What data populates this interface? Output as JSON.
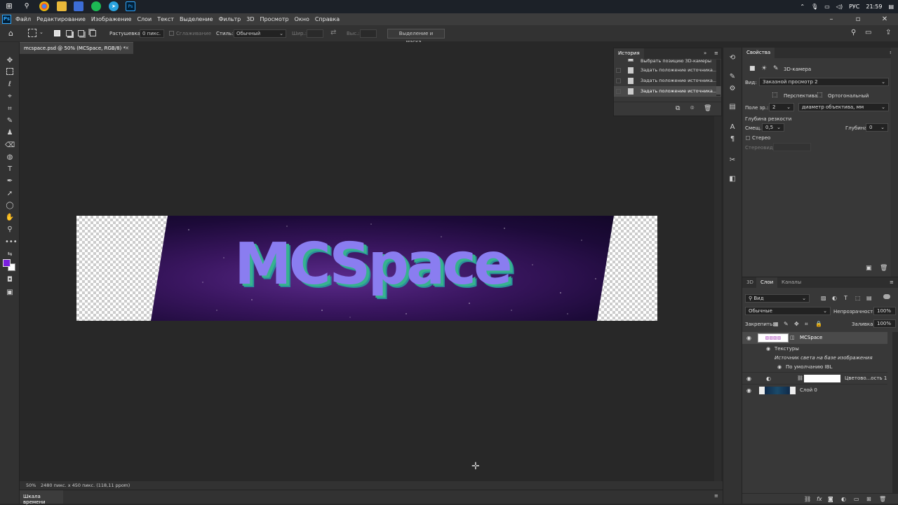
{
  "taskbar": {
    "tray": {
      "language": "РУС",
      "time": "21:59"
    }
  },
  "menubar": {
    "app_icon": "Ps",
    "items": [
      "Файл",
      "Редактирование",
      "Изображение",
      "Слои",
      "Текст",
      "Выделение",
      "Фильтр",
      "3D",
      "Просмотр",
      "Окно",
      "Справка"
    ],
    "window_controls": [
      "–",
      "▫",
      "✕"
    ]
  },
  "options": {
    "feather_label": "Растушевка:",
    "feather_value": "0 пикс.",
    "antialias_label": "Сглаживание",
    "style_label": "Стиль:",
    "style_value": "Обычный",
    "width_label": "Шир.:",
    "height_label": "Выс.:",
    "select_mask_button": "Выделение и маска..."
  },
  "document": {
    "tab_title": "mcspace.psd @ 50% (MCSpace, RGB/8) *",
    "logo_text": "MCSpace",
    "zoom": "50%",
    "doc_info": "2480 пикс. x 450 пикс. (118,11 ppcm)"
  },
  "history": {
    "title": "История",
    "items": [
      "Выбрать позицию 3D-камеры",
      "Задать положение источника...",
      "Задать положение источника...",
      "Задать положение источника..."
    ]
  },
  "properties": {
    "title": "Свойства",
    "section": "3D-камера",
    "view_label": "Вид:",
    "view_value": "Заказной просмотр 2",
    "perspective": "Перспектива",
    "orthographic": "Ортогональный",
    "fov_label": "Поле зр.:",
    "fov_value": "2",
    "fov_unit": "диаметр объектива, мм",
    "dof_label": "Глубина резкости",
    "offset_label": "Смещ.:",
    "offset_value": "0,5",
    "depth_label": "Глубина:",
    "depth_value": "0",
    "stereo_label": "Стерео",
    "stereo_sub_label": "Стереовид:"
  },
  "layers": {
    "tabs": [
      "3D",
      "Слои",
      "Каналы"
    ],
    "filter_value": "Вид",
    "blend_value": "Обычные",
    "opacity_label": "Непрозрачность:",
    "opacity_value": "100%",
    "lock_label": "Закрепить:",
    "fill_label": "Заливка:",
    "fill_value": "100%",
    "list": {
      "l1_name": "MCSpace",
      "l1_sub1": "Текстуры",
      "l1_sub2": "Источник света на базе изображения",
      "l1_sub3": "По умолчанию IBL",
      "l2_name": "Цветово...ость 1",
      "l3_name": "Слой 0"
    }
  },
  "timeline": {
    "title": "Шкала времени"
  },
  "colors": {
    "foreground": "#7a1ee0",
    "background": "#ffffff",
    "accent": "#31a8ff"
  }
}
